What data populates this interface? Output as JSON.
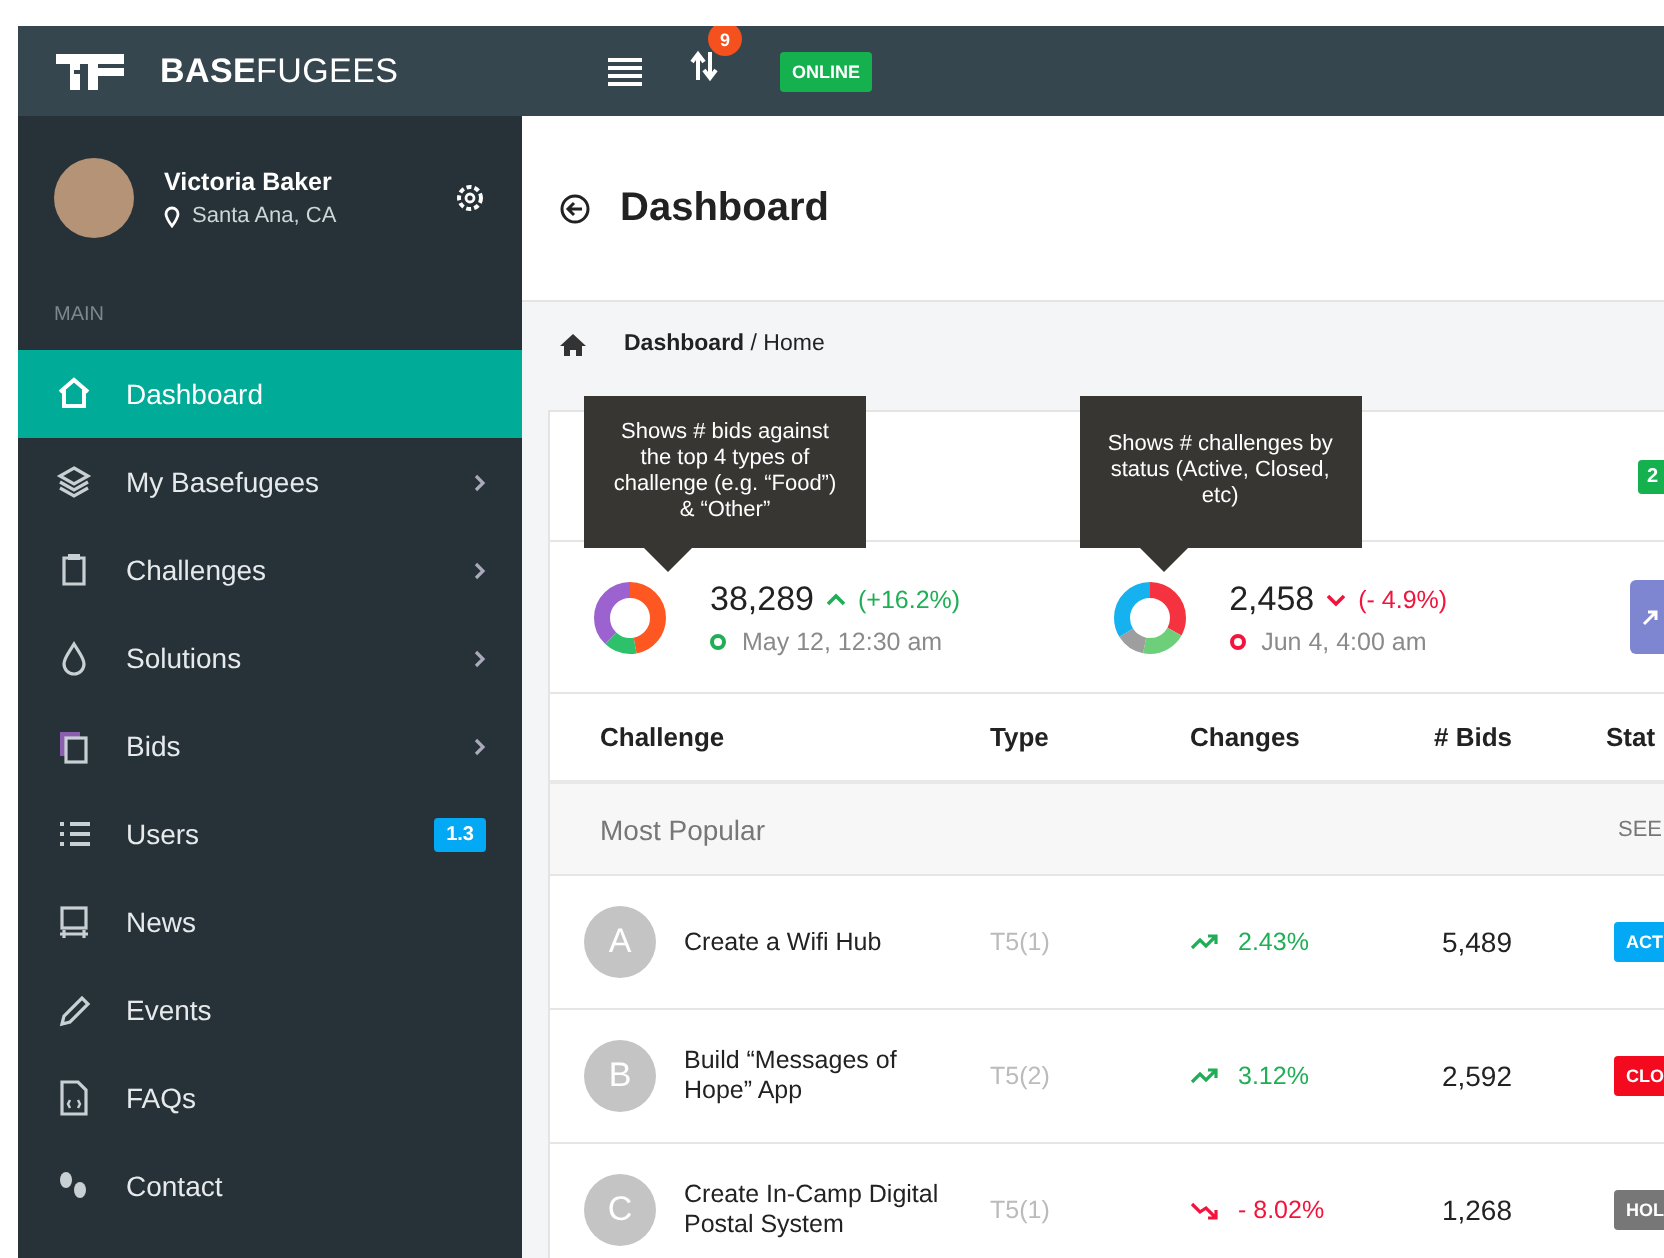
{
  "topbar": {
    "brand_bold": "BASE",
    "brand_light": "FUGEES",
    "notification_count": "9",
    "status": "ONLINE"
  },
  "user": {
    "name": "Victoria Baker",
    "location": "Santa Ana, CA"
  },
  "sidebar": {
    "section": "MAIN",
    "items": [
      {
        "label": "Dashboard",
        "selected": true,
        "submenu": false
      },
      {
        "label": "My Basefugees",
        "selected": false,
        "submenu": true
      },
      {
        "label": "Challenges",
        "selected": false,
        "submenu": true
      },
      {
        "label": "Solutions",
        "selected": false,
        "submenu": true
      },
      {
        "label": "Bids",
        "selected": false,
        "submenu": true
      },
      {
        "label": "Users",
        "selected": false,
        "submenu": false,
        "badge": "1.3"
      },
      {
        "label": "News",
        "selected": false,
        "submenu": false
      },
      {
        "label": "Events",
        "selected": false,
        "submenu": false
      },
      {
        "label": "FAQs",
        "selected": false,
        "submenu": false
      },
      {
        "label": "Contact",
        "selected": false,
        "submenu": false
      }
    ]
  },
  "page": {
    "title": "Dashboard",
    "breadcrumb": "**Dashboard** / Home"
  },
  "summary": {
    "badge": "2",
    "stats": [
      {
        "tooltip": "Shows # bids against the top 4 types of challenge (e.g. “Food”) & “Other”",
        "value": "38,289",
        "change": "(+16.2%)",
        "kind": "up",
        "date": "May 12, 12:30 am"
      },
      {
        "tooltip": "Shows # challenges by status (Active, Closed, etc)",
        "value": "2,458",
        "change": "(- 4.9%)",
        "kind": "down",
        "date": "Jun 4, 4:00 am"
      }
    ]
  },
  "table": {
    "columns": [
      "Challenge",
      "Type",
      "Changes",
      "# Bids",
      "Stat"
    ],
    "section": {
      "title": "Most Popular",
      "action": "SEE"
    },
    "rows": [
      {
        "initial": "A",
        "challenge": "Create a Wifi Hub",
        "type": "T5(1)",
        "change": "2.43%",
        "kind": "up",
        "bids": "5,489",
        "status": "ACT",
        "color": "#03a9f4"
      },
      {
        "initial": "B",
        "challenge": "Build “Messages of Hope” App",
        "type": "T5(2)",
        "change": "3.12%",
        "kind": "up",
        "bids": "2,592",
        "status": "CLO",
        "color": "#f40a1e"
      },
      {
        "initial": "C",
        "challenge": "Create In-Camp Digital Postal System",
        "type": "T5(1)",
        "change": "- 8.02%",
        "kind": "down",
        "bids": "1,268",
        "status": "HOL",
        "color": "#777777"
      }
    ]
  }
}
